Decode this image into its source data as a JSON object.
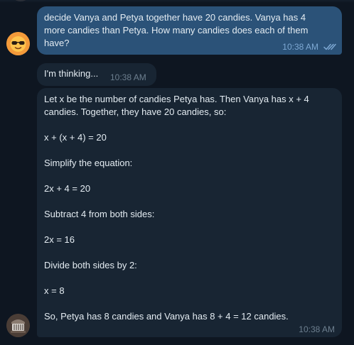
{
  "messages": {
    "outgoing": {
      "line1": "decide Vanya and Petya together have 20 candies. Vanya has 4",
      "line2": "more candies than Petya. How many candies does each of them",
      "line3": "have?",
      "time": "10:38 AM",
      "status_icon": "double-check-icon"
    },
    "thinking": {
      "text": "I'm thinking...",
      "time": "10:38 AM"
    },
    "answer": {
      "lines": [
        "Let x be the number of candies Petya has. Then Vanya has x + 4",
        "candies. Together, they have 20 candies, so:",
        "x + (x + 4) = 20",
        "Simplify the equation:",
        "2x + 4 = 20",
        "Subtract 4 from both sides:",
        "2x = 16",
        "Divide both sides by 2:",
        "x = 8",
        "So, Petya has 8 candies and Vanya has 8 + 4 = 12 candies."
      ],
      "time": "10:38 AM"
    }
  },
  "avatars": {
    "user": "sunglasses-emoji-avatar",
    "bot": "bot-avatar"
  },
  "colors": {
    "background": "#0e1621",
    "outgoing_bubble": "#2b5278",
    "incoming_bubble": "#182533",
    "text": "#e4ecf2",
    "outgoing_time": "#7da8d3",
    "incoming_time": "#6d7f8f"
  }
}
